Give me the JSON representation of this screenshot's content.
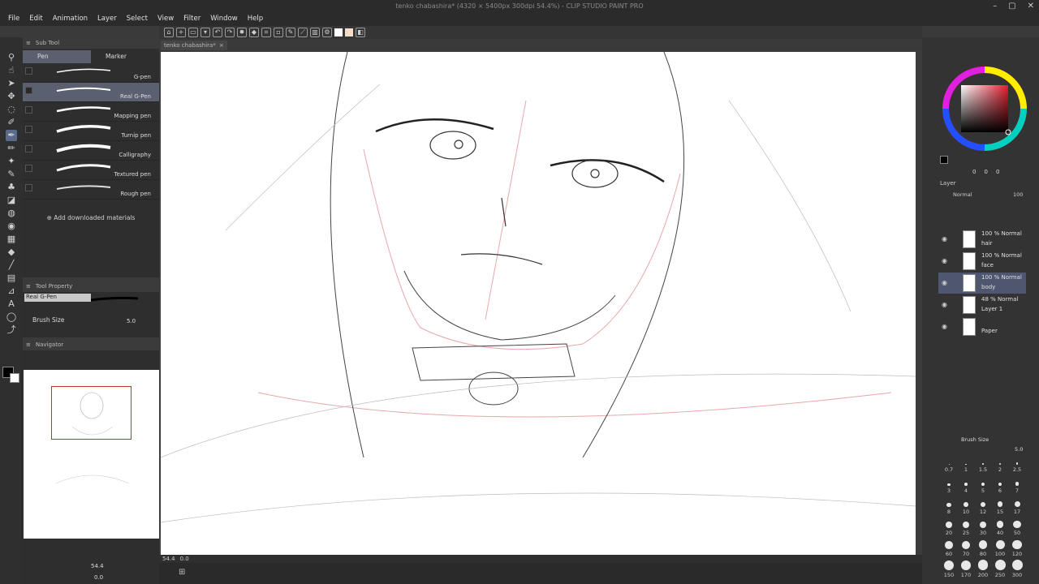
{
  "window": {
    "title": "tenko chabashira* (4320 × 5400px 300dpi 54.4%) - CLIP STUDIO PAINT PRO"
  },
  "menu": [
    "File",
    "Edit",
    "Animation",
    "Layer",
    "Select",
    "View",
    "Filter",
    "Window",
    "Help"
  ],
  "tab": {
    "label": "tenko chabashira*",
    "close": "×"
  },
  "subtool": {
    "header": "Sub Tool",
    "tabs": [
      "Pen",
      "Marker"
    ],
    "brushes": [
      {
        "label": "G-pen",
        "selected": false
      },
      {
        "label": "Real G-Pen",
        "selected": true
      },
      {
        "label": "Mapping pen",
        "selected": false
      },
      {
        "label": "Turnip pen",
        "selected": false
      },
      {
        "label": "Calligraphy",
        "selected": false
      },
      {
        "label": "Textured pen",
        "selected": false
      },
      {
        "label": "Rough pen",
        "selected": false
      }
    ],
    "add_materials": "Add downloaded materials"
  },
  "tool_property": {
    "header": "Tool Property",
    "preset": "Real G-Pen",
    "brush_size_label": "Brush Size",
    "brush_size_value": "5.0"
  },
  "navigator": {
    "header": "Navigator",
    "zoom": "54.4",
    "rotate": "0.0"
  },
  "status": {
    "zoom": "54.4",
    "angle": "0.0"
  },
  "color": {
    "values": [
      "0",
      "0",
      "0"
    ],
    "main": "#000000",
    "sub": "#ffffff",
    "accent": "#c0303a"
  },
  "layer_panel": {
    "header": "Layer",
    "blend": "Normal",
    "opacity": "100",
    "layers": [
      {
        "mode": "100 % Normal",
        "name": "hair",
        "selected": false
      },
      {
        "mode": "100 % Normal",
        "name": "face",
        "selected": false
      },
      {
        "mode": "100 % Normal",
        "name": "body",
        "selected": true
      },
      {
        "mode": "48 % Normal",
        "name": "Layer 1",
        "selected": false
      },
      {
        "mode": "",
        "name": "Paper",
        "selected": false
      }
    ]
  },
  "brush_size_panel": {
    "header": "Brush Size",
    "value": "5.0",
    "sizes": [
      "0.7",
      "1",
      "1.5",
      "2",
      "2.5",
      "3",
      "4",
      "5",
      "6",
      "7",
      "8",
      "10",
      "12",
      "15",
      "17",
      "20",
      "25",
      "30",
      "40",
      "50",
      "60",
      "70",
      "80",
      "100",
      "120",
      "150",
      "170",
      "200",
      "250",
      "300"
    ]
  }
}
